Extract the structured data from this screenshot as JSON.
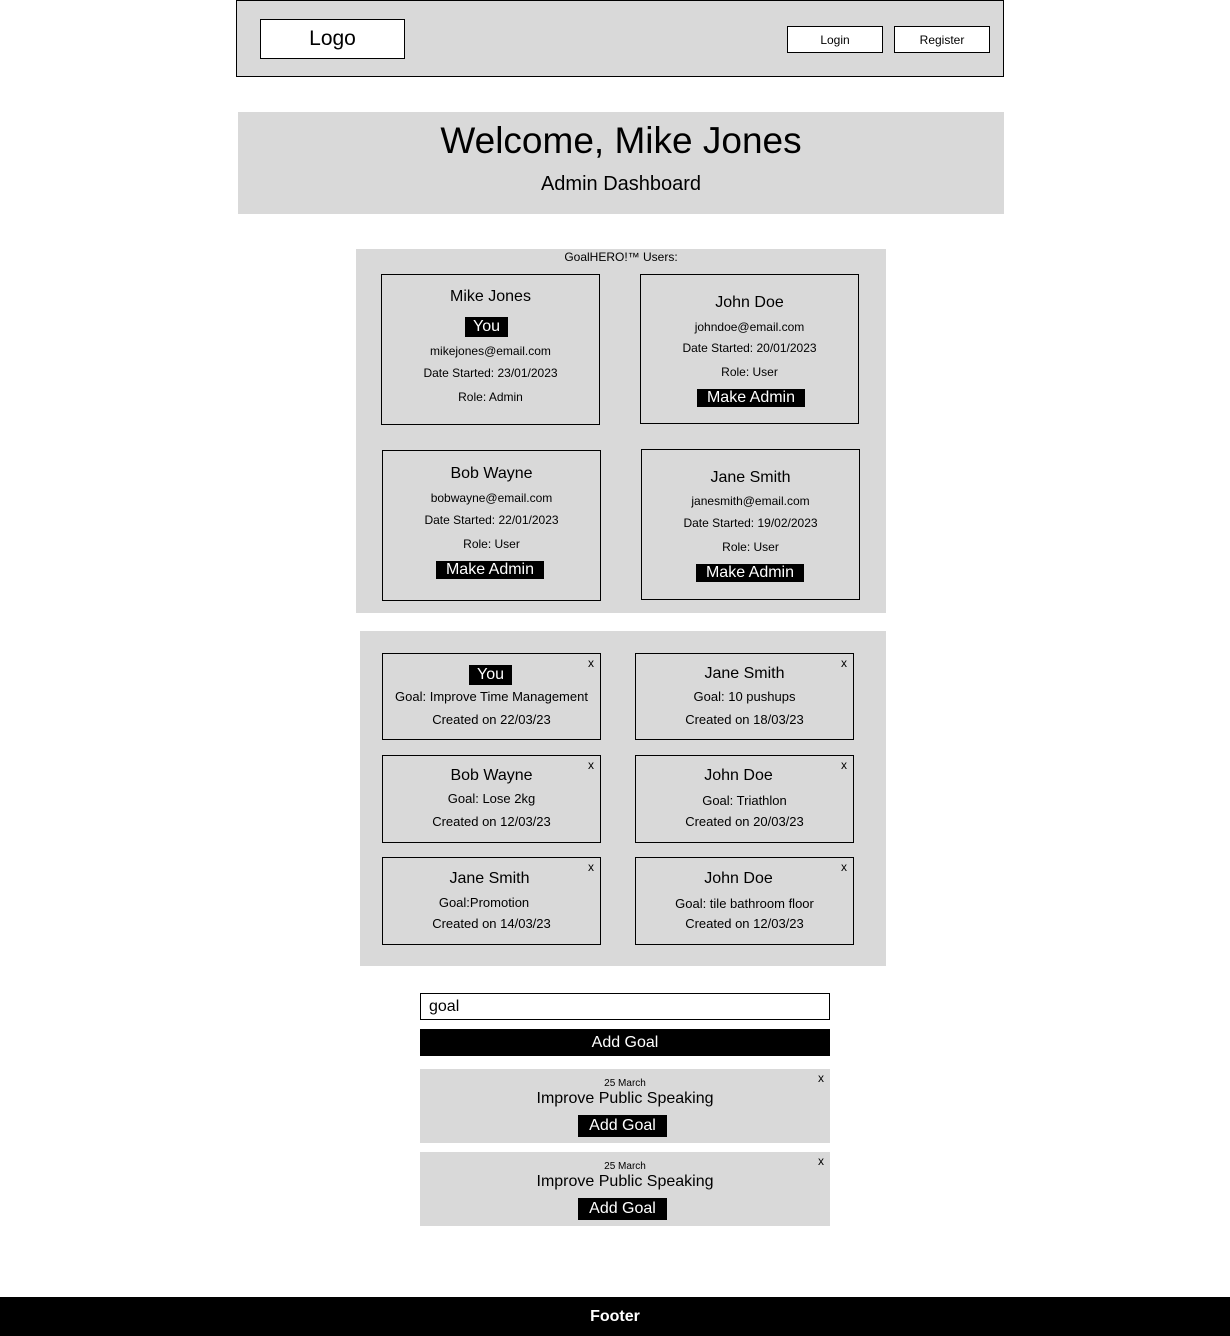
{
  "header": {
    "logo": "Logo",
    "login_label": "Login",
    "register_label": "Register"
  },
  "welcome": {
    "title": "Welcome, Mike Jones",
    "subtitle": "Admin Dashboard"
  },
  "users": {
    "title": "GoalHERO!™ Users:",
    "cards": [
      {
        "name": "Mike Jones",
        "badge": "You",
        "email": "mikejones@email.com",
        "date": "Date Started: 23/01/2023",
        "role": "Role: Admin"
      },
      {
        "name": "John Doe",
        "email": "johndoe@email.com",
        "date": "Date Started: 20/01/2023",
        "role": "Role: User",
        "action": "Make Admin"
      },
      {
        "name": "Bob Wayne",
        "email": "bobwayne@email.com",
        "date": "Date Started: 22/01/2023",
        "role": "Role: User",
        "action": "Make Admin"
      },
      {
        "name": "Jane Smith",
        "email": "janesmith@email.com",
        "date": "Date Started: 19/02/2023",
        "role": "Role: User",
        "action": "Make Admin"
      }
    ]
  },
  "goals": {
    "close_label": "x",
    "cards": [
      {
        "name": "You",
        "goal": "Goal: Improve Time Management",
        "created": "Created on 22/03/23"
      },
      {
        "name": "Jane Smith",
        "goal": "Goal: 10 pushups",
        "created": "Created on 18/03/23"
      },
      {
        "name": "Bob Wayne",
        "goal": "Goal: Lose 2kg",
        "created": "Created on 12/03/23"
      },
      {
        "name": "John Doe",
        "goal": "Goal: Triathlon",
        "created": "Created on 20/03/23"
      },
      {
        "name": "Jane Smith",
        "goal": "Goal:Promotion",
        "created": "Created on 14/03/23"
      },
      {
        "name": "John Doe",
        "goal": "Goal: tile bathroom floor",
        "created": "Created on 12/03/23"
      }
    ]
  },
  "add_goal": {
    "input_value": "goal",
    "button_label": "Add Goal"
  },
  "suggestions": [
    {
      "date": "25 March",
      "title": "Improve Public Speaking",
      "button_label": "Add Goal",
      "close_label": "x"
    },
    {
      "date": "25 March",
      "title": "Improve Public Speaking",
      "button_label": "Add Goal",
      "close_label": "x"
    }
  ],
  "footer": {
    "label": "Footer"
  }
}
